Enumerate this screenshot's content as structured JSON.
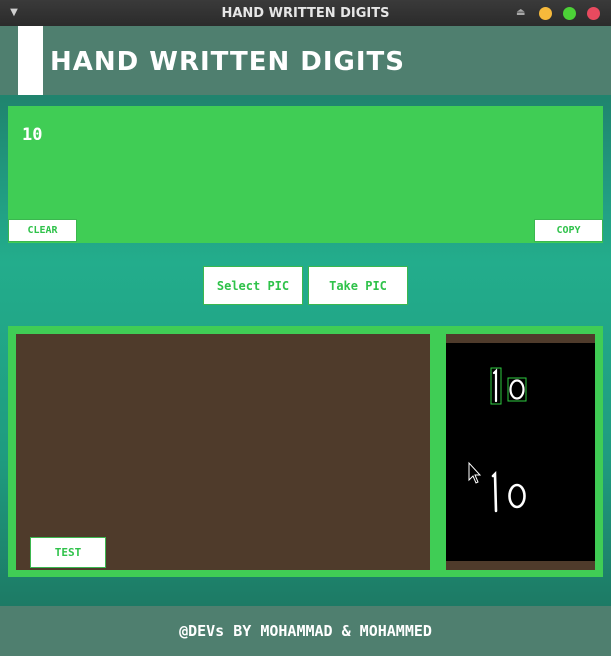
{
  "window": {
    "title": "HAND WRITTEN DIGITS",
    "controls": {
      "menu_icon": "chevron-down-icon",
      "shade_icon": "eject-icon",
      "minimize_color": "#f6b93b",
      "maximize_color": "#4cd137",
      "close_color": "#e84a5f"
    }
  },
  "header": {
    "title": "HAND WRITTEN DIGITS"
  },
  "result": {
    "text": "10",
    "clear_label": "CLEAR",
    "copy_label": "COPY"
  },
  "actions": {
    "select_label": "Select PIC",
    "take_label": "Take PIC"
  },
  "workspace": {
    "test_label": "TEST",
    "preview": {
      "annotated_digits": "10",
      "raw_digits": "10"
    }
  },
  "footer": {
    "text": "@DEVs BY MOHAMMAD & MOHAMMED"
  },
  "colors": {
    "accent": "#40cd55",
    "header": "#4f7f6f",
    "canvas": "#4f3b2b"
  }
}
